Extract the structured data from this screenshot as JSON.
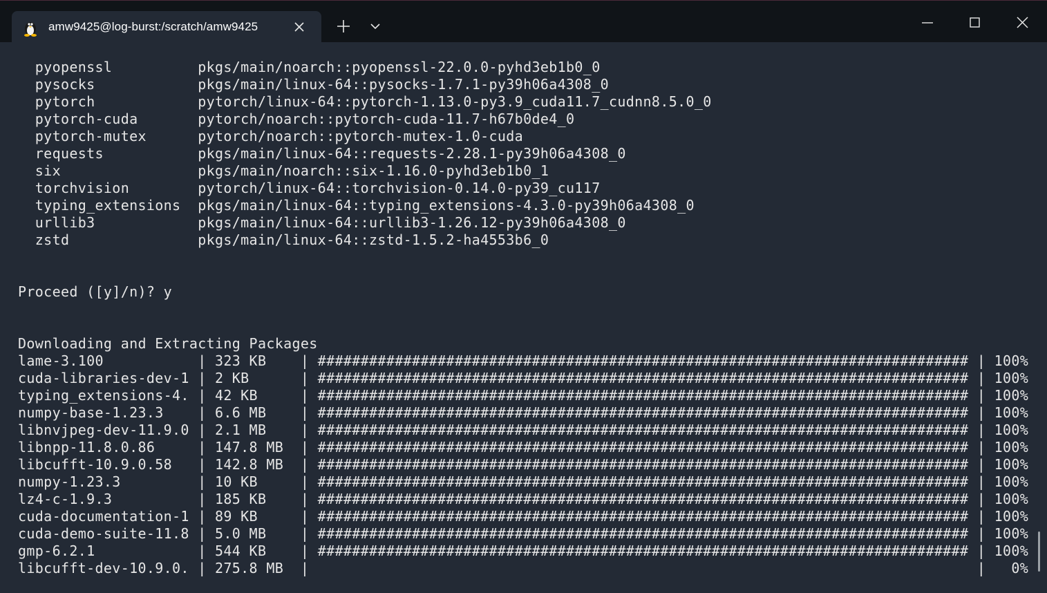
{
  "window": {
    "tab_title": "amw9425@log-burst:/scratch/amw9425"
  },
  "terminal": {
    "package_plan": [
      "  pyopenssl          pkgs/main/noarch::pyopenssl-22.0.0-pyhd3eb1b0_0",
      "  pysocks            pkgs/main/linux-64::pysocks-1.7.1-py39h06a4308_0",
      "  pytorch            pytorch/linux-64::pytorch-1.13.0-py3.9_cuda11.7_cudnn8.5.0_0",
      "  pytorch-cuda       pytorch/noarch::pytorch-cuda-11.7-h67b0de4_0",
      "  pytorch-mutex      pytorch/noarch::pytorch-mutex-1.0-cuda",
      "  requests           pkgs/main/linux-64::requests-2.28.1-py39h06a4308_0",
      "  six                pkgs/main/noarch::six-1.16.0-pyhd3eb1b0_1",
      "  torchvision        pytorch/linux-64::torchvision-0.14.0-py39_cu117",
      "  typing_extensions  pkgs/main/linux-64::typing_extensions-4.3.0-py39h06a4308_0",
      "  urllib3            pkgs/main/linux-64::urllib3-1.26.12-py39h06a4308_0",
      "  zstd               pkgs/main/linux-64::zstd-1.5.2-ha4553b6_0"
    ],
    "proceed_prompt": "Proceed ([y]/n)? y",
    "download_header": "Downloading and Extracting Packages",
    "downloads": [
      "lame-3.100           | 323 KB    | ############################################################################ | 100% ",
      "cuda-libraries-dev-1 | 2 KB      | ############################################################################ | 100% ",
      "typing_extensions-4. | 42 KB     | ############################################################################ | 100% ",
      "numpy-base-1.23.3    | 6.6 MB    | ############################################################################ | 100% ",
      "libnvjpeg-dev-11.9.0 | 2.1 MB    | ############################################################################ | 100% ",
      "libnpp-11.8.0.86     | 147.8 MB  | ############################################################################ | 100% ",
      "libcufft-10.9.0.58   | 142.8 MB  | ############################################################################ | 100% ",
      "numpy-1.23.3         | 10 KB     | ############################################################################ | 100% ",
      "lz4-c-1.9.3          | 185 KB    | ############################################################################ | 100% ",
      "cuda-documentation-1 | 89 KB     | ############################################################################ | 100% ",
      "cuda-demo-suite-11.8 | 5.0 MB    | ############################################################################ | 100% ",
      "gmp-6.2.1            | 544 KB    | ############################################################################ | 100% ",
      "libcufft-dev-10.9.0. | 275.8 MB  |                                                                              |   0% "
    ]
  }
}
